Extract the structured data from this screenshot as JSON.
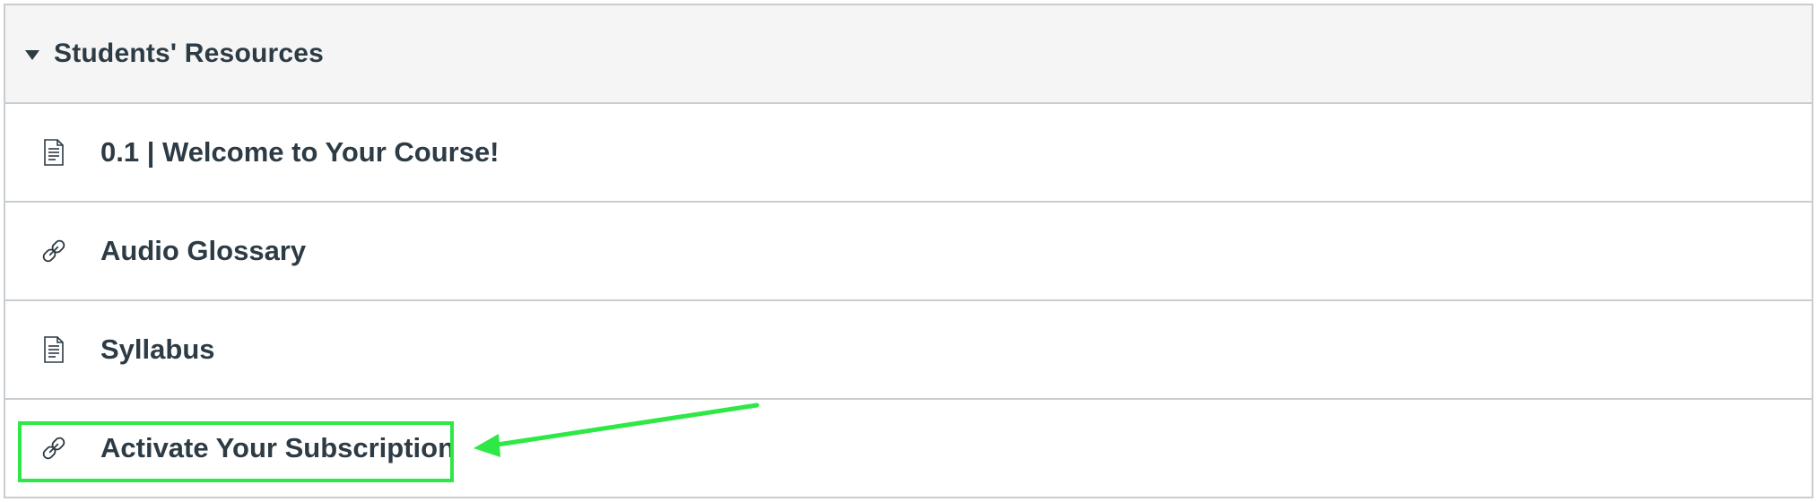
{
  "module": {
    "title": "Students' Resources",
    "items": [
      {
        "title": "0.1 | Welcome to Your Course!",
        "icon": "page-icon"
      },
      {
        "title": "Audio Glossary",
        "icon": "link-icon"
      },
      {
        "title": "Syllabus",
        "icon": "page-icon"
      },
      {
        "title": "Activate Your Subscription",
        "icon": "link-icon"
      }
    ]
  },
  "annotation": {
    "color": "#2ee845",
    "highlighted_item": "Activate Your Subscription"
  }
}
